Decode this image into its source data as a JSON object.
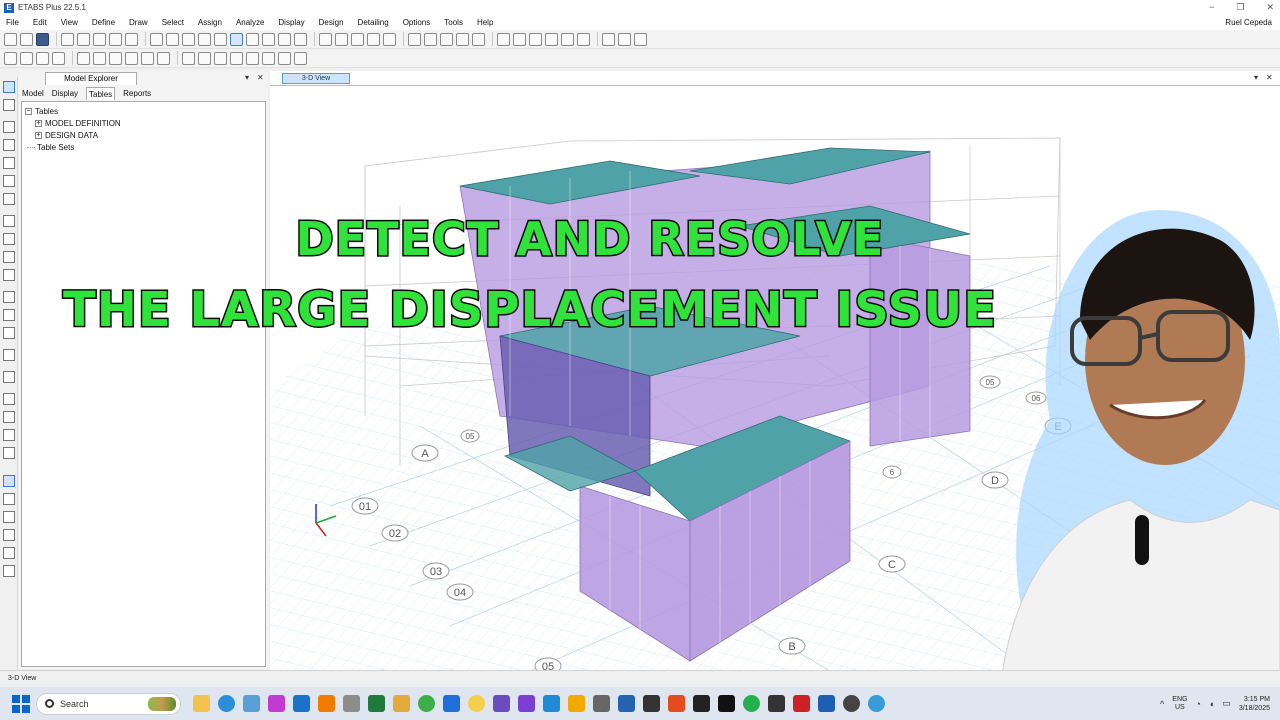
{
  "window": {
    "app_title": "ETABS Plus 22.5.1",
    "user_name": "Ruel Cepeda",
    "controls": [
      "−",
      "❐",
      "✕"
    ]
  },
  "menu": {
    "items": [
      "File",
      "Edit",
      "View",
      "Define",
      "Draw",
      "Select",
      "Assign",
      "Analyze",
      "Display",
      "Design",
      "Detailing",
      "Options",
      "Tools",
      "Help"
    ]
  },
  "model_explorer": {
    "title": "Model Explorer",
    "pin_glyph": "▾",
    "close_glyph": "✕",
    "tabs": [
      "Model",
      "Display",
      "Tables",
      "Reports"
    ],
    "active_tab": "Tables",
    "tree": {
      "root": "Tables",
      "children": [
        "MODEL DEFINITION",
        "DESIGN DATA"
      ],
      "sibling": "Table Sets"
    }
  },
  "view": {
    "tab_label": "3-D View",
    "pin_glyph": "▾",
    "close_glyph": "✕",
    "grid_labels": [
      "01",
      "02",
      "03",
      "04",
      "05",
      "A",
      "B",
      "C",
      "D",
      "E",
      "05",
      "06",
      "05",
      "6"
    ]
  },
  "overlay": {
    "line1": "DETECT AND RESOLVE",
    "line2": "THE LARGE DISPLACEMENT ISSUE",
    "text_color": "#2fe33a"
  },
  "status": {
    "text": "3-D View"
  },
  "taskbar": {
    "search_placeholder": "Search",
    "lang_line1": "ENG",
    "lang_line2": "US",
    "time": "3:15 PM",
    "date": "3/18/2025",
    "tray_arrow": "^"
  },
  "colors": {
    "accent": "#1e5fb4",
    "building_walls": "#b79be0",
    "building_slabs": "#4fa3a8",
    "grid_lines": "#cfe2f5"
  }
}
